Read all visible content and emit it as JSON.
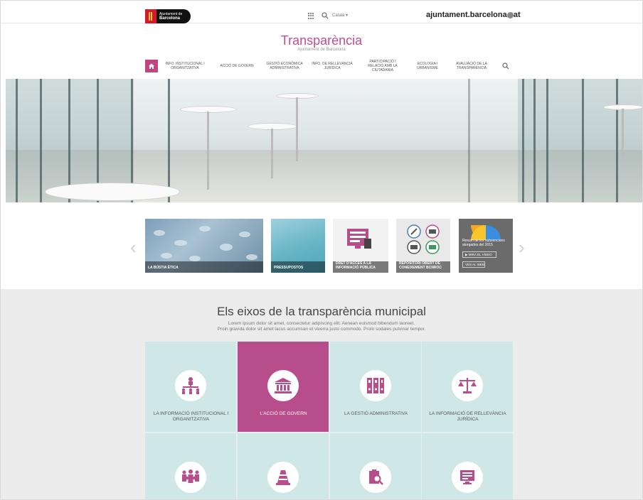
{
  "topbar": {
    "logo_line1": "Ajuntament de",
    "logo_line2": "Barcelona",
    "language": "Català ▾",
    "domain": "ajuntament.barcelona.cat"
  },
  "site": {
    "title": "Transparència",
    "subtitle": "Ajuntament de Barcelona"
  },
  "nav": {
    "items": [
      "Info. institucional i organitzativa",
      "Acció de govern",
      "Gestió econòmica administrativa",
      "Info. de rellevància jurídica",
      "Participació i relació amb la ciutadania",
      "Ecologia i urbanisme",
      "Avaluació de la transparència"
    ]
  },
  "carousel": {
    "tiles": [
      {
        "label": "La bústia ètica"
      },
      {
        "label": "Pressupostos"
      },
      {
        "label": "Dret d'accés a la informació pública"
      },
      {
        "label": "Repositori obert de coneixement BCNROC"
      },
      {
        "label": "Resum de les subvencions atorgades del 2015",
        "btn1": "MIRA EL VÍDEO",
        "btn2": "VES AL WEB"
      }
    ]
  },
  "section": {
    "title": "Els eixos de la transparència municipal",
    "text_line1": "Lorem ipsum dolor sit amet, consectetur adipiscing elit. Aenean euismod bibendum laoreet.",
    "text_line2": "Proin gravida dolor sit amet lacus accumsan et viverra justo commodo. Proin sodales pulvinar tempor."
  },
  "grid": {
    "items": [
      {
        "label": "La informació institucional i organitzativa",
        "icon": "org-chart-icon"
      },
      {
        "label": "L'acció de govern",
        "icon": "government-building-icon"
      },
      {
        "label": "La gestió administrativa",
        "icon": "binders-icon"
      },
      {
        "label": "La informació de rellevància jurídica",
        "icon": "scales-icon"
      },
      {
        "label": "",
        "icon": "people-icon"
      },
      {
        "label": "",
        "icon": "traffic-cone-icon"
      },
      {
        "label": "",
        "icon": "document-search-icon"
      },
      {
        "label": "",
        "icon": "monitor-icon"
      }
    ]
  },
  "colors": {
    "accent": "#c0447f",
    "tile_bg": "#cfe7e7",
    "active_tile": "#b84d8b"
  }
}
